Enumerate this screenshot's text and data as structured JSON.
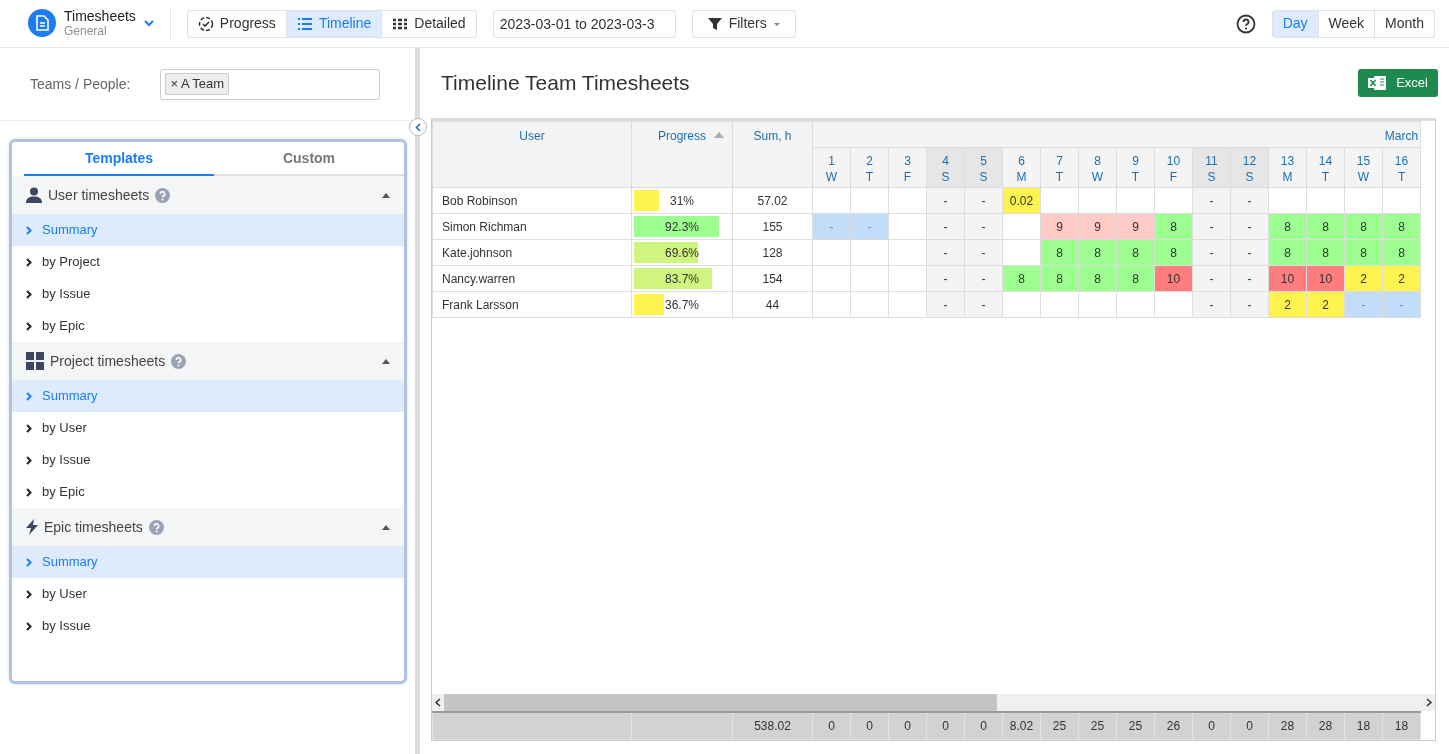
{
  "app": {
    "title": "Timesheets",
    "subtitle": "General"
  },
  "views": [
    {
      "label": "Progress",
      "kind": "progress",
      "selected": false
    },
    {
      "label": "Timeline",
      "kind": "timeline",
      "selected": true
    },
    {
      "label": "Detailed",
      "kind": "detailed",
      "selected": false
    }
  ],
  "date_range": {
    "value": "2023-03-01 to 2023-03-3"
  },
  "filters": {
    "label": "Filters"
  },
  "periods": [
    {
      "label": "Day",
      "selected": true
    },
    {
      "label": "Week",
      "selected": false
    },
    {
      "label": "Month",
      "selected": false
    }
  ],
  "teams": {
    "label": "Teams / People:",
    "tags": [
      {
        "remove": "×",
        "label": "A Team"
      }
    ]
  },
  "template_tabs": [
    {
      "label": "Templates",
      "selected": true
    },
    {
      "label": "Custom",
      "selected": false
    }
  ],
  "sections": [
    {
      "title": "User timesheets",
      "kind": "user",
      "expanded": true,
      "items": [
        {
          "label": "Summary",
          "selected": true
        },
        {
          "label": "by Project",
          "selected": false
        },
        {
          "label": "by Issue",
          "selected": false
        },
        {
          "label": "by Epic",
          "selected": false
        }
      ]
    },
    {
      "title": "Project timesheets",
      "kind": "project",
      "expanded": true,
      "items": [
        {
          "label": "Summary",
          "selected": true
        },
        {
          "label": "by User",
          "selected": false
        },
        {
          "label": "by Issue",
          "selected": false
        },
        {
          "label": "by Epic",
          "selected": false
        }
      ]
    },
    {
      "title": "Epic timesheets",
      "kind": "epic",
      "expanded": true,
      "items": [
        {
          "label": "Summary",
          "selected": true
        },
        {
          "label": "by User",
          "selected": false
        },
        {
          "label": "by Issue",
          "selected": false
        }
      ]
    }
  ],
  "report": {
    "title": "Timeline Team Timesheets",
    "export": "Excel"
  },
  "table": {
    "columns": [
      "User",
      "Progress",
      "Sum, h"
    ],
    "month": "March",
    "days": [
      {
        "day": "1",
        "weekday": "W",
        "weekend": false
      },
      {
        "day": "2",
        "weekday": "T",
        "weekend": false
      },
      {
        "day": "3",
        "weekday": "F",
        "weekend": false
      },
      {
        "day": "4",
        "weekday": "S",
        "weekend": true
      },
      {
        "day": "5",
        "weekday": "S",
        "weekend": true
      },
      {
        "day": "6",
        "weekday": "M",
        "weekend": false
      },
      {
        "day": "7",
        "weekday": "T",
        "weekend": false
      },
      {
        "day": "8",
        "weekday": "W",
        "weekend": false
      },
      {
        "day": "9",
        "weekday": "T",
        "weekend": false
      },
      {
        "day": "10",
        "weekday": "F",
        "weekend": false
      },
      {
        "day": "11",
        "weekday": "S",
        "weekend": true
      },
      {
        "day": "12",
        "weekday": "S",
        "weekend": true
      },
      {
        "day": "13",
        "weekday": "M",
        "weekend": false
      },
      {
        "day": "14",
        "weekday": "T",
        "weekend": false
      },
      {
        "day": "15",
        "weekday": "W",
        "weekend": false
      },
      {
        "day": "16",
        "weekday": "T",
        "weekend": false
      }
    ],
    "rows": [
      {
        "user": "Bob Robinson",
        "progress": "31%",
        "level": 0.29,
        "color": "#fff44f",
        "sum": "57.02",
        "cells": [
          null,
          null,
          null,
          {
            "text": "-"
          },
          {
            "text": "-"
          },
          {
            "text": "0.02",
            "color": "#fff44f"
          },
          null,
          null,
          null,
          null,
          {
            "text": "-"
          },
          {
            "text": "-"
          },
          null,
          null,
          null,
          null
        ]
      },
      {
        "user": "Simon Richman",
        "progress": "92.3%",
        "level": 0.89,
        "color": "#9cff8f",
        "sum": "155",
        "cells": [
          {
            "text": "-",
            "color": "#c2ddfa"
          },
          {
            "text": "-",
            "color": "#c2ddfa"
          },
          null,
          {
            "text": "-"
          },
          {
            "text": "-"
          },
          null,
          {
            "text": "9",
            "color": "#ffcbc6"
          },
          {
            "text": "9",
            "color": "#ffcbc6"
          },
          {
            "text": "9",
            "color": "#ffcbc6"
          },
          {
            "text": "8",
            "color": "#9cff8f"
          },
          {
            "text": "-"
          },
          {
            "text": "-"
          },
          {
            "text": "8",
            "color": "#9cff8f"
          },
          {
            "text": "8",
            "color": "#9cff8f"
          },
          {
            "text": "8",
            "color": "#9cff8f"
          },
          {
            "text": "8",
            "color": "#9cff8f"
          }
        ]
      },
      {
        "user": "Kate.johnson",
        "progress": "69.6%",
        "level": 0.68,
        "color": "#d0f57f",
        "sum": "128",
        "cells": [
          null,
          null,
          null,
          {
            "text": "-"
          },
          {
            "text": "-"
          },
          null,
          {
            "text": "8",
            "color": "#9cff8f"
          },
          {
            "text": "8",
            "color": "#9cff8f"
          },
          {
            "text": "8",
            "color": "#9cff8f"
          },
          {
            "text": "8",
            "color": "#9cff8f"
          },
          {
            "text": "-"
          },
          {
            "text": "-"
          },
          {
            "text": "8",
            "color": "#9cff8f"
          },
          {
            "text": "8",
            "color": "#9cff8f"
          },
          {
            "text": "8",
            "color": "#9cff8f"
          },
          {
            "text": "8",
            "color": "#9cff8f"
          }
        ]
      },
      {
        "user": "Nancy.warren",
        "progress": "83.7%",
        "level": 0.82,
        "color": "#d0f57f",
        "sum": "154",
        "cells": [
          null,
          null,
          null,
          {
            "text": "-"
          },
          {
            "text": "-"
          },
          {
            "text": "8",
            "color": "#9cff8f"
          },
          {
            "text": "8",
            "color": "#9cff8f"
          },
          {
            "text": "8",
            "color": "#9cff8f"
          },
          {
            "text": "8",
            "color": "#9cff8f"
          },
          {
            "text": "10",
            "color": "#ff7d7d"
          },
          {
            "text": "-"
          },
          {
            "text": "-"
          },
          {
            "text": "10",
            "color": "#ff7d7d"
          },
          {
            "text": "10",
            "color": "#ff7d7d"
          },
          {
            "text": "2",
            "color": "#fff44f"
          },
          {
            "text": "2",
            "color": "#fff44f"
          }
        ]
      },
      {
        "user": "Frank Larsson",
        "progress": "36.7%",
        "level": 0.34,
        "color": "#fff44f",
        "sum": "44",
        "cells": [
          null,
          null,
          null,
          {
            "text": "-"
          },
          {
            "text": "-"
          },
          null,
          null,
          null,
          null,
          null,
          {
            "text": "-"
          },
          {
            "text": "-"
          },
          {
            "text": "2",
            "color": "#fff44f"
          },
          {
            "text": "2",
            "color": "#fff44f"
          },
          {
            "text": "-",
            "color": "#c2ddfa"
          },
          {
            "text": "-",
            "color": "#c2ddfa"
          }
        ]
      }
    ],
    "totals": {
      "sum": "538.02",
      "days": [
        "0",
        "0",
        "0",
        "0",
        "0",
        "8.02",
        "25",
        "25",
        "25",
        "26",
        "0",
        "0",
        "28",
        "28",
        "18",
        "18"
      ]
    }
  }
}
